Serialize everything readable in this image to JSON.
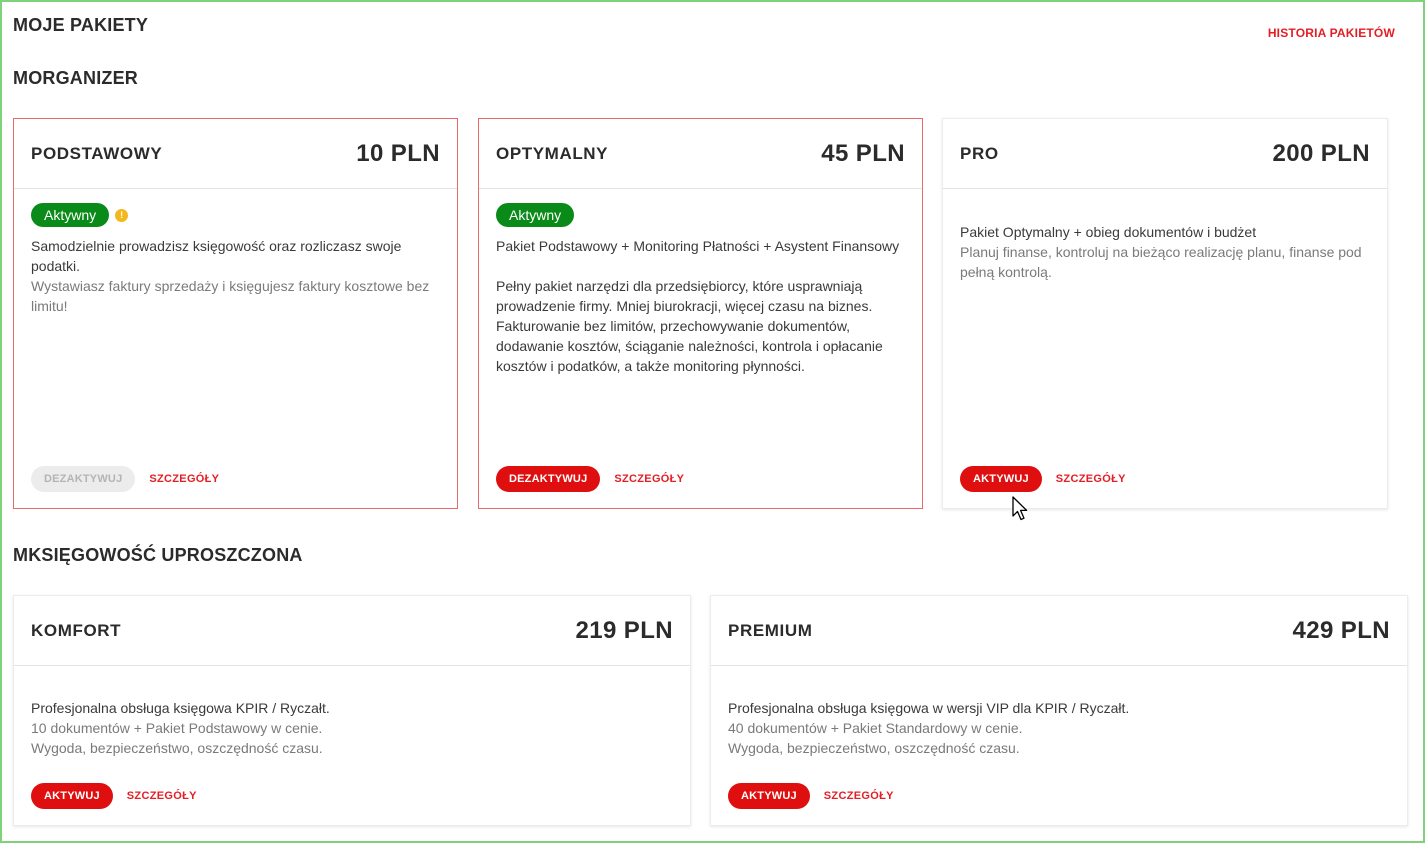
{
  "header": {
    "title": "MOJE PAKIETY",
    "history_link": "HISTORIA PAKIETÓW"
  },
  "colors": {
    "accent_red": "#e31e24",
    "button_red": "#e00f0f",
    "active_green": "#0a8a18",
    "warning_yellow": "#f4b71c",
    "frame_green": "#7ed37a"
  },
  "morganizer": {
    "title": "MORGANIZER",
    "cards": [
      {
        "name": "PODSTAWOWY",
        "price": "10 PLN",
        "status": "Aktywny",
        "warning_icon": "!",
        "lead": "Samodzielnie prowadzisz księgowość oraz rozliczasz swoje podatki.",
        "sub": "Wystawiasz faktury sprzedaży i księgujesz faktury kosztowe bez limitu!",
        "button": "DEZAKTYWUJ",
        "details": "SZCZEGÓŁY"
      },
      {
        "name": "OPTYMALNY",
        "price": "45 PLN",
        "status": "Aktywny",
        "lead": "Pakiet Podstawowy + Monitoring Płatności + Asystent Finansowy",
        "lead2": "Pełny pakiet narzędzi dla przedsiębiorcy, które usprawniają prowadzenie firmy. Mniej biurokracji, więcej czasu na biznes.",
        "lead3": "Fakturowanie bez limitów, przechowywanie dokumentów, dodawanie kosztów, ściąganie należności, kontrola i opłacanie kosztów i podatków, a także monitoring płynności.",
        "button": "DEZAKTYWUJ",
        "details": "SZCZEGÓŁY"
      },
      {
        "name": "PRO",
        "price": "200 PLN",
        "lead": "Pakiet Optymalny + obieg dokumentów i budżet",
        "sub": "Planuj finanse, kontroluj na bieżąco realizację planu, finanse pod pełną kontrolą.",
        "button": "AKTYWUJ",
        "details": "SZCZEGÓŁY"
      }
    ]
  },
  "mksiegowosc": {
    "title": "MKSIĘGOWOŚĆ UPROSZCZONA",
    "cards": [
      {
        "name": "KOMFORT",
        "price": "219 PLN",
        "lead": "Profesjonalna obsługa księgowa KPIR / Ryczałt.",
        "sub1": "10 dokumentów + Pakiet Podstawowy w cenie.",
        "sub2": "Wygoda, bezpieczeństwo, oszczędność czasu.",
        "button": "AKTYWUJ",
        "details": "SZCZEGÓŁY"
      },
      {
        "name": "PREMIUM",
        "price": "429 PLN",
        "lead": "Profesjonalna obsługa księgowa w wersji VIP dla KPIR / Ryczałt.",
        "sub1": "40 dokumentów + Pakiet Standardowy w cenie.",
        "sub2": "Wygoda, bezpieczeństwo, oszczędność czasu.",
        "button": "AKTYWUJ",
        "details": "SZCZEGÓŁY"
      }
    ]
  }
}
